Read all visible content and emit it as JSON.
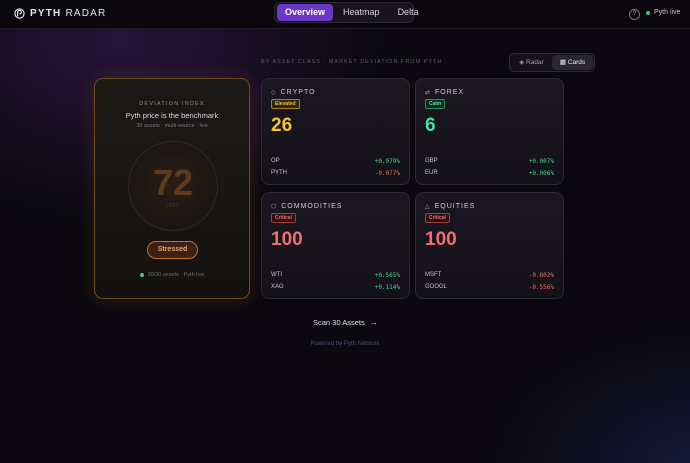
{
  "brand": {
    "name_bold": "PYTH",
    "name_rest": "RADAR",
    "logo_icon": "pyth-logo-icon"
  },
  "nav": {
    "tabs": [
      {
        "label": "Overview",
        "active": true
      },
      {
        "label": "Heatmap",
        "active": false
      },
      {
        "label": "Delta",
        "active": false
      }
    ],
    "help_label": "?",
    "live_label": "Pyth live",
    "live_color": "#34d07a"
  },
  "subtitle": "BY ASSET CLASS · MARKET DEVIATION FROM PYTH",
  "view_toggle": {
    "options": [
      {
        "icon": "◈",
        "label": "Radar",
        "active": false
      },
      {
        "icon": "▦",
        "label": "Cards",
        "active": true
      }
    ]
  },
  "deviation_index": {
    "label": "DEVIATION INDEX",
    "headline": "Pyth price is the benchmark",
    "sub": "30 assets · multi-source · live",
    "value": "72",
    "unit": "/100",
    "status": "Stressed",
    "footer": "30/30 assets · Pyth live"
  },
  "cards": [
    {
      "icon": "◇",
      "title": "CRYPTO",
      "status": "Elevated",
      "status_class": "elevated",
      "score": "26",
      "score_class": "yellow",
      "rows": [
        {
          "name": "OP",
          "value": "+0.079%",
          "sign": "pos"
        },
        {
          "name": "PYTH",
          "value": "-0.077%",
          "sign": "neg"
        }
      ]
    },
    {
      "icon": "⇄",
      "title": "FOREX",
      "status": "Calm",
      "status_class": "calm",
      "score": "6",
      "score_class": "green",
      "rows": [
        {
          "name": "GBP",
          "value": "+0.007%",
          "sign": "pos"
        },
        {
          "name": "EUR",
          "value": "+0.006%",
          "sign": "pos"
        }
      ]
    },
    {
      "icon": "⬡",
      "title": "COMMODITIES",
      "status": "Critical",
      "status_class": "critical",
      "score": "100",
      "score_class": "red",
      "rows": [
        {
          "name": "WTI",
          "value": "+0.565%",
          "sign": "pos"
        },
        {
          "name": "XAG",
          "value": "+0.114%",
          "sign": "pos"
        }
      ]
    },
    {
      "icon": "△",
      "title": "EQUITIES",
      "status": "Critical",
      "status_class": "critical",
      "score": "100",
      "score_class": "red",
      "rows": [
        {
          "name": "MSFT",
          "value": "-0.802%",
          "sign": "neg"
        },
        {
          "name": "GOOGL",
          "value": "-0.556%",
          "sign": "neg"
        }
      ]
    }
  ],
  "scan_button": {
    "label": "Scan 30 Assets",
    "icon": "→"
  },
  "powered_by": "Powered by Pyth Network"
}
